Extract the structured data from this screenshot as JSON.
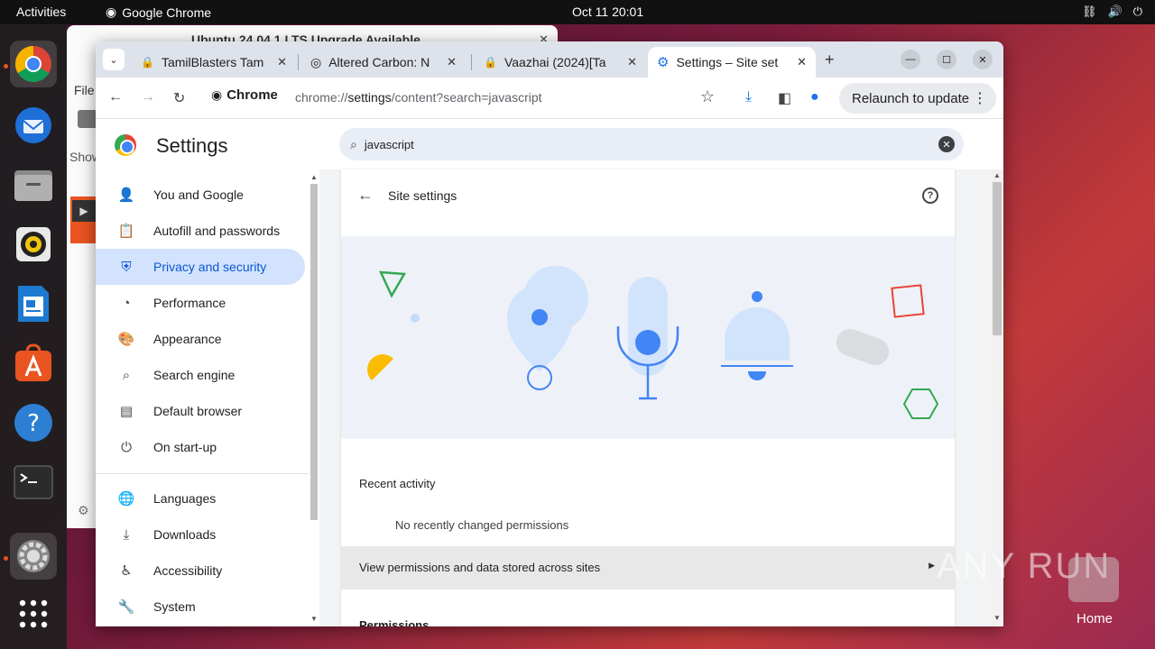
{
  "topbar": {
    "activities": "Activities",
    "app": "Google Chrome",
    "datetime": "Oct 11  20:01"
  },
  "dock": {
    "items": [
      "chrome-icon",
      "thunderbird-icon",
      "files-icon",
      "rhythmbox-icon",
      "writer-icon",
      "app-center-icon",
      "help-icon",
      "terminal-icon",
      "settings-icon",
      "show-apps-icon"
    ]
  },
  "background_window": {
    "title": "Ubuntu 24.04.1 LTS Upgrade Available",
    "file_menu": "File",
    "show_label": "Show"
  },
  "tabs": [
    {
      "title": "TamilBlasters Tam"
    },
    {
      "title": "Altered Carbon: N"
    },
    {
      "title": "Vaazhai (2024)[Ta"
    },
    {
      "title": "Settings – Site set"
    }
  ],
  "toolbar": {
    "chip": "Chrome",
    "url_prefix": "chrome://",
    "url_host": "settings",
    "url_path": "/content?search=javascript",
    "relaunch": "Relaunch to update"
  },
  "settings": {
    "title": "Settings",
    "search_value": "javascript"
  },
  "nav": [
    {
      "label": "You and Google"
    },
    {
      "label": "Autofill and passwords"
    },
    {
      "label": "Privacy and security"
    },
    {
      "label": "Performance"
    },
    {
      "label": "Appearance"
    },
    {
      "label": "Search engine"
    },
    {
      "label": "Default browser"
    },
    {
      "label": "On start-up"
    },
    {
      "label": "Languages"
    },
    {
      "label": "Downloads"
    },
    {
      "label": "Accessibility"
    },
    {
      "label": "System"
    }
  ],
  "content": {
    "title": "Site settings",
    "recent_heading": "Recent activity",
    "no_recent": "No recently changed permissions",
    "view_permissions": "View permissions and data stored across sites",
    "permissions_heading": "Permissions"
  },
  "desktop": {
    "watermark": "ANY RUN",
    "home_label": "Home"
  },
  "colors": {
    "accent": "#0b57d0",
    "selected_nav_bg": "#d3e3fd",
    "tabstrip": "#dee3eb",
    "ubuntu_orange": "#e95420"
  }
}
